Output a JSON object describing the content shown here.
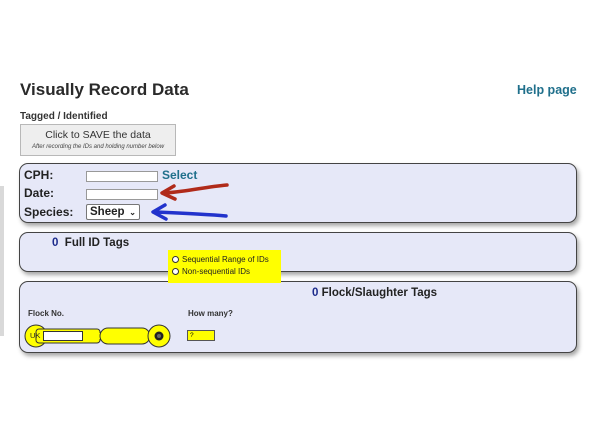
{
  "page": {
    "title": "Visually Record Data",
    "help_link": "Help page",
    "section_label": "Tagged / Identified"
  },
  "save_button": {
    "label": "Click to SAVE the data",
    "sublabel": "After recording the IDs and holding number below"
  },
  "holding": {
    "cph_label": "CPH:",
    "cph_value": "",
    "select_link": "Select",
    "date_label": "Date:",
    "date_value": "",
    "species_label": "Species:",
    "species_selected": "Sheep"
  },
  "full_id": {
    "count": "0",
    "title": "Full ID Tags",
    "options": [
      "Sequential Range of IDs",
      "Non-sequential IDs"
    ]
  },
  "flock": {
    "count": "0",
    "title": "Flock/Slaughter Tags",
    "flock_no_label": "Flock No.",
    "how_many_label": "How many?",
    "uk_prefix": "UK",
    "flock_no_value": "",
    "how_many_value": "?"
  },
  "colors": {
    "panel_bg": "#e6e8f8",
    "highlight": "#ffff00",
    "link": "#1f6f8b",
    "count": "#1c2b8c",
    "arrow_red": "#b02a1a",
    "arrow_blue": "#2233cc"
  },
  "icons": {
    "select_chevron": "chevron-down-icon",
    "radio": "radio-button-icon",
    "tag": "ear-tag-icon",
    "arrows": [
      "red-arrow-icon",
      "blue-arrow-icon"
    ]
  }
}
